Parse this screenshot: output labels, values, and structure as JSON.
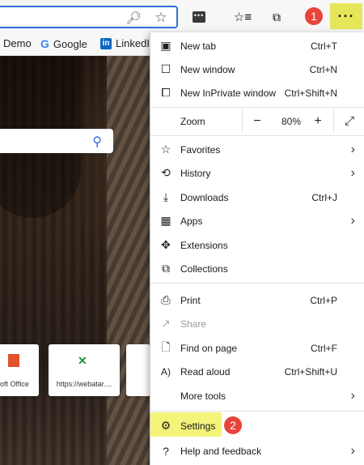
{
  "toolbar": {
    "zoom_icon": "zoom-icon",
    "favorite_icon": "star-icon",
    "more_label": "···"
  },
  "favorites_bar": {
    "items": [
      "Demo",
      "Google",
      "LinkedIn"
    ]
  },
  "tiles": [
    {
      "label": "oft Office"
    },
    {
      "label": "https://webatar...."
    }
  ],
  "menu": {
    "new_tab": {
      "label": "New tab",
      "shortcut": "Ctrl+T"
    },
    "new_window": {
      "label": "New window",
      "shortcut": "Ctrl+N"
    },
    "new_inprivate": {
      "label": "New InPrivate window",
      "shortcut": "Ctrl+Shift+N"
    },
    "zoom": {
      "label": "Zoom",
      "minus": "−",
      "value": "80%",
      "plus": "+"
    },
    "favorites": {
      "label": "Favorites"
    },
    "history": {
      "label": "History"
    },
    "downloads": {
      "label": "Downloads",
      "shortcut": "Ctrl+J"
    },
    "apps": {
      "label": "Apps"
    },
    "extensions": {
      "label": "Extensions"
    },
    "collections": {
      "label": "Collections"
    },
    "print": {
      "label": "Print",
      "shortcut": "Ctrl+P"
    },
    "share": {
      "label": "Share"
    },
    "find": {
      "label": "Find on page",
      "shortcut": "Ctrl+F"
    },
    "read_aloud": {
      "label": "Read aloud",
      "shortcut": "Ctrl+Shift+U"
    },
    "more_tools": {
      "label": "More tools"
    },
    "settings": {
      "label": "Settings"
    },
    "help": {
      "label": "Help and feedback"
    }
  },
  "badges": {
    "step1": "1",
    "step2": "2"
  },
  "colors": {
    "highlight": "#e6e65a",
    "badge": "#e8443b",
    "address_border": "#2f6fd6"
  }
}
